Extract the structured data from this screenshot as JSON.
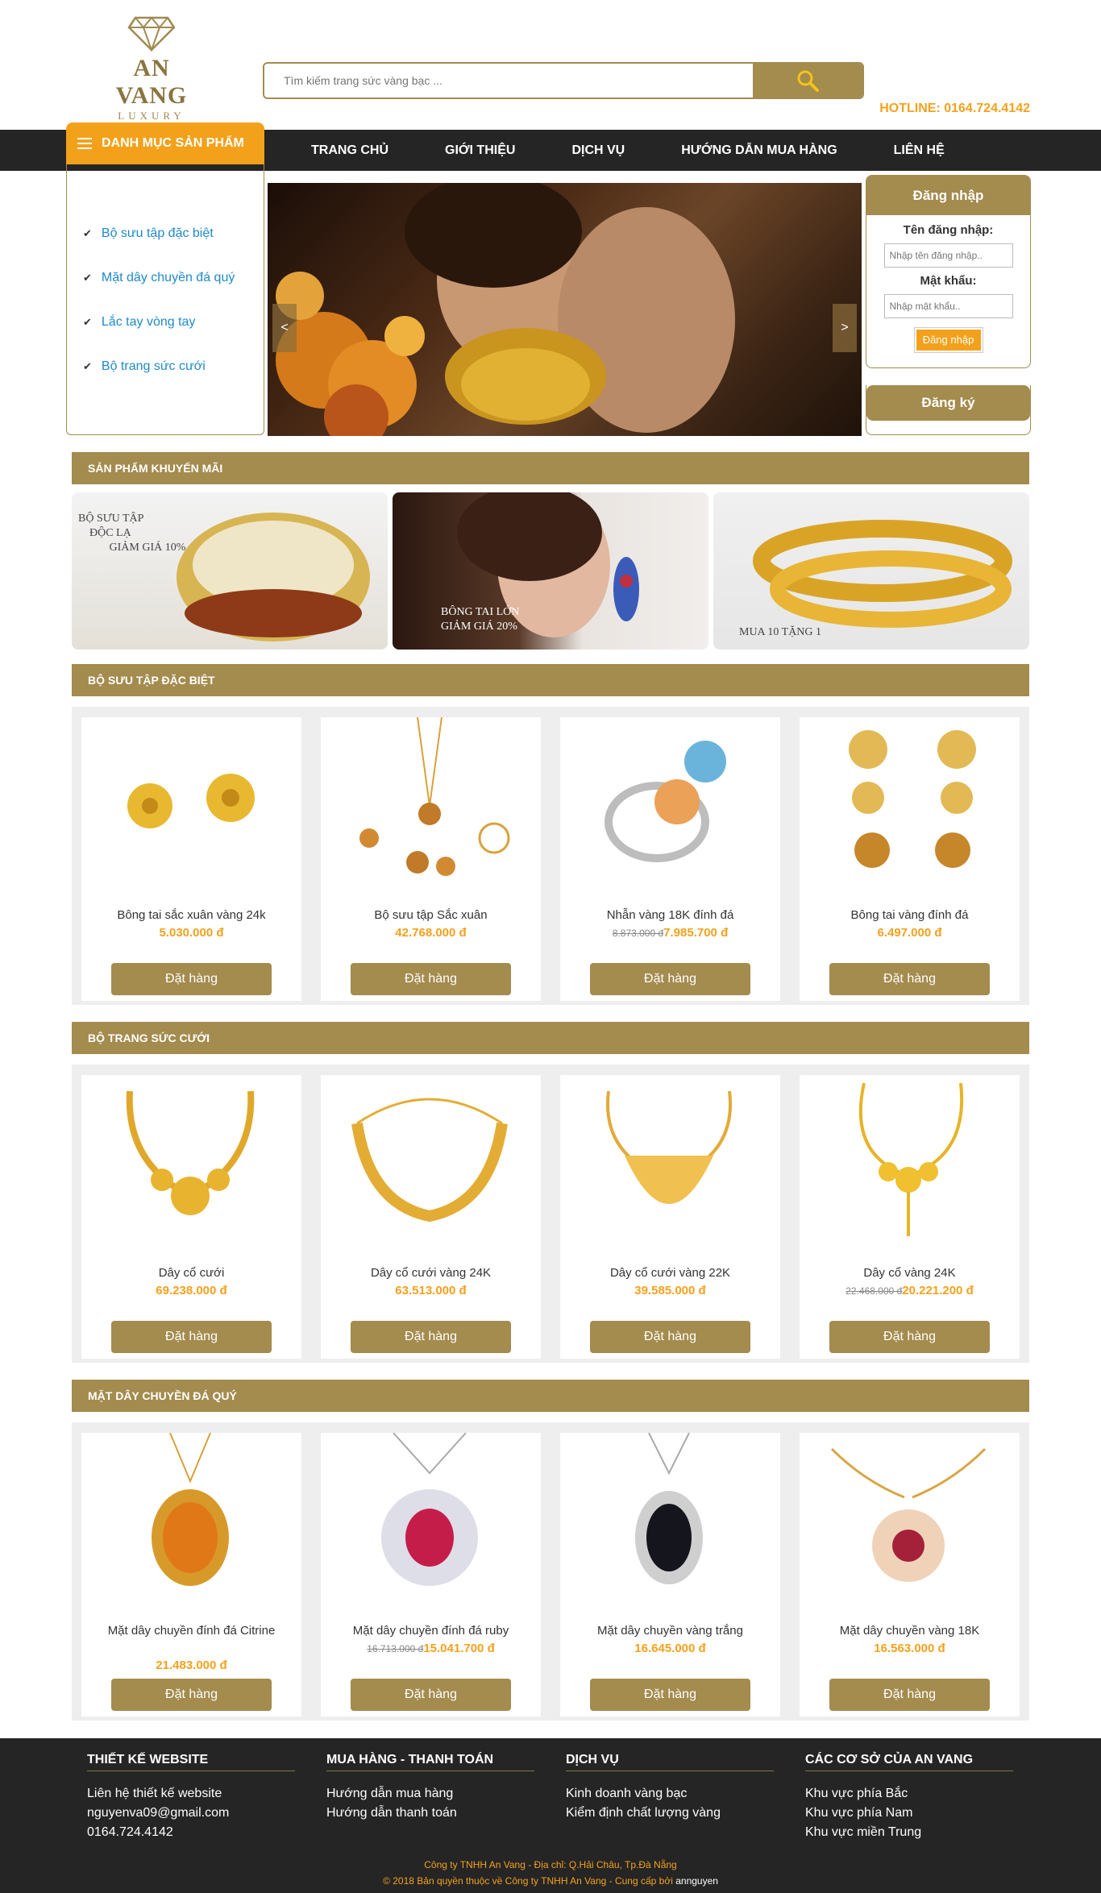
{
  "brand": {
    "name": "AN VANG",
    "tagline": "LUXURY"
  },
  "search": {
    "placeholder": "Tìm kiếm trang sức vàng bạc ..."
  },
  "hotline": "HOTLINE: 0164.724.4142",
  "category": {
    "title": "DANH MỤC SẢN PHẨM",
    "items": [
      "Bộ sưu tập đặc biệt",
      "Mặt dây chuyền đá quý",
      "Lắc tay vòng tay",
      "Bộ trang sức cưới"
    ]
  },
  "menu": [
    "TRANG CHỦ",
    "GIỚI THIỆU",
    "DỊCH VỤ",
    "HƯỚNG DẪN MUA HÀNG",
    "LIÊN HỆ"
  ],
  "slider": {
    "prev": "<",
    "next": ">"
  },
  "login": {
    "title": "Đăng nhập",
    "user_label": "Tên đăng nhập:",
    "user_placeholder": "Nhập tên đăng nhập..",
    "pass_label": "Mật khẩu:",
    "pass_placeholder": "Nhập mật khẩu..",
    "submit": "Đăng nhập",
    "register": "Đăng ký"
  },
  "promo": {
    "title": "SẢN PHẨM KHUYẾN MÃI",
    "banners": [
      {
        "l1": "Bộ sưu tập",
        "l2": "độc lạ",
        "l3": "giảm giá 10%"
      },
      {
        "l1": "Bông tai lớn",
        "l2": "giảm giá 20%"
      },
      {
        "l1": "Mua 10 tặng 1"
      }
    ]
  },
  "sections": [
    {
      "title": "BỘ SƯU TẬP ĐẶC BIỆT",
      "products": [
        {
          "name": "Bông tai sắc xuân vàng 24k",
          "old": "",
          "price": "5.030.000 đ"
        },
        {
          "name": "Bộ sưu tập Sắc xuân",
          "old": "",
          "price": "42.768.000 đ"
        },
        {
          "name": "Nhẫn vàng 18K đính đá",
          "old": "8.873.000 đ",
          "price": "7.985.700 đ"
        },
        {
          "name": "Bông tai vàng đính đá",
          "old": "",
          "price": "6.497.000 đ"
        }
      ]
    },
    {
      "title": "BỘ TRANG SỨC CƯỚI",
      "products": [
        {
          "name": "Dây cổ cưới",
          "old": "",
          "price": "69.238.000 đ"
        },
        {
          "name": "Dây cổ cưới vàng 24K",
          "old": "",
          "price": "63.513.000 đ"
        },
        {
          "name": "Dây cổ cưới vàng 22K",
          "old": "",
          "price": "39.585.000 đ"
        },
        {
          "name": "Dây cổ vàng 24K",
          "old": "22.468.000 đ",
          "price": "20.221.200 đ"
        }
      ]
    },
    {
      "title": "MẶT DÂY CHUYỀN ĐÁ QUÝ",
      "products": [
        {
          "name": "Mặt dây chuyền đính đá Citrine",
          "old": "",
          "price": "21.483.000 đ"
        },
        {
          "name": "Mặt dây chuyền đính đá ruby",
          "old": "16.713.000 đ",
          "price": "15.041.700 đ"
        },
        {
          "name": "Mặt dây chuyền vàng trắng",
          "old": "",
          "price": "16.645.000 đ"
        },
        {
          "name": "Mặt dây chuyền vàng 18K",
          "old": "",
          "price": "16.563.000 đ"
        }
      ]
    }
  ],
  "buy_label": "Đặt hàng",
  "footer": {
    "cols": [
      {
        "title": "THIẾT KẾ WEBSITE",
        "links": [
          "Liên hệ thiết kế website",
          "nguyenva09@gmail.com",
          "0164.724.4142"
        ]
      },
      {
        "title": "MUA HÀNG - THANH TOÁN",
        "links": [
          "Hướng dẫn mua hàng",
          "Hướng dẫn thanh toán"
        ]
      },
      {
        "title": "DỊCH VỤ",
        "links": [
          "Kinh doanh vàng bạc",
          "Kiểm định chất lượng vàng"
        ]
      },
      {
        "title": "CÁC CƠ SỞ CỦA AN VANG",
        "links": [
          "Khu vực phía Bắc",
          "Khu vực phía Nam",
          "Khu vực miền Trung"
        ]
      }
    ],
    "company": "Công ty TNHH An Vang - Địa chỉ: Q.Hải Châu, Tp.Đà Nẵng",
    "copyright": "© 2018 Bản quyền thuộc về Công ty TNHH An Vang - Cung cấp bởi",
    "author": "annguyen"
  }
}
